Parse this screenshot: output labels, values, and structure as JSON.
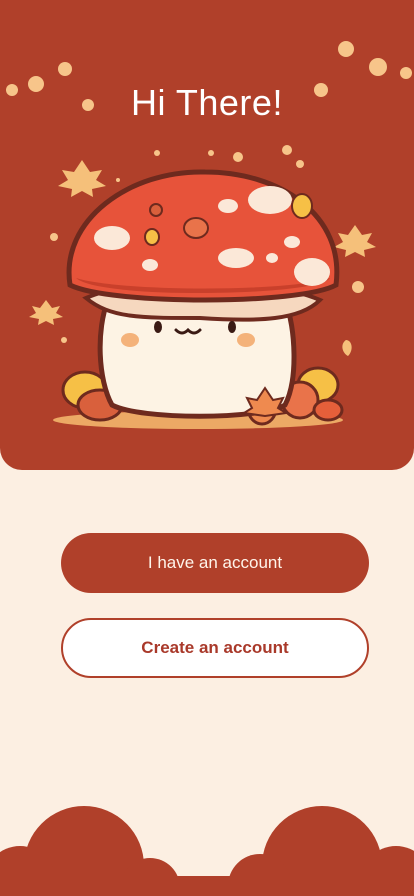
{
  "hero": {
    "title": "Hi There!"
  },
  "actions": {
    "login_label": "I have an account",
    "signup_label": "Create an account"
  },
  "colors": {
    "primary": "#b0402a",
    "background": "#fcefe2",
    "accent_leaf": "#f5c07a"
  },
  "icons": {
    "illustration": "mushroom-character-icon"
  }
}
